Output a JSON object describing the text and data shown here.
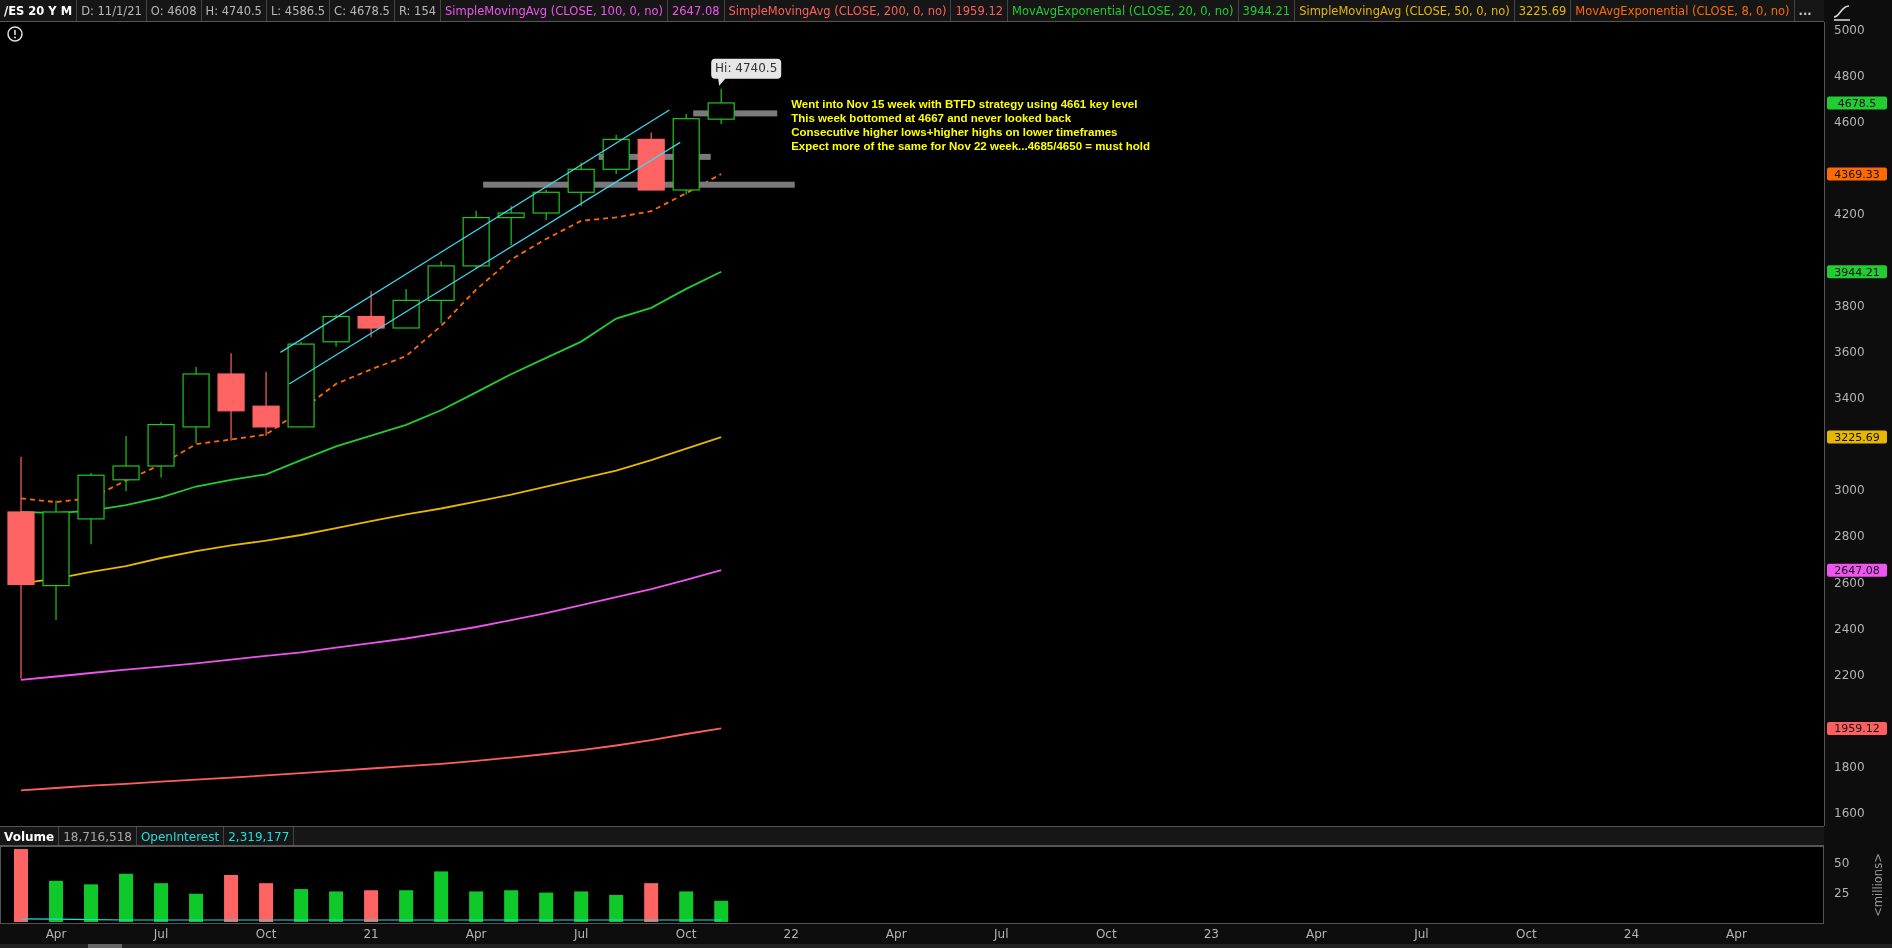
{
  "legend": [
    {
      "kind": "symbol",
      "text": "/ES 20 Y M",
      "color": "#ffffff"
    },
    {
      "kind": "field",
      "text": "D: 11/1/21",
      "color": "#b8b8b8"
    },
    {
      "kind": "field",
      "text": "O: 4608",
      "color": "#b8b8b8"
    },
    {
      "kind": "field",
      "text": "H: 4740.5",
      "color": "#b8b8b8"
    },
    {
      "kind": "field",
      "text": "L: 4586.5",
      "color": "#b8b8b8"
    },
    {
      "kind": "field",
      "text": "C: 4678.5",
      "color": "#b8b8b8"
    },
    {
      "kind": "field",
      "text": "R: 154",
      "color": "#b8b8b8"
    },
    {
      "kind": "study",
      "text": "SimpleMovingAvg (CLOSE, 100, 0, no)",
      "color": "#ee55ee"
    },
    {
      "kind": "study",
      "text": "2647.08",
      "color": "#ee55ee"
    },
    {
      "kind": "study",
      "text": "SimpleMovingAvg (CLOSE, 200, 0, no)",
      "color": "#ff5f5f"
    },
    {
      "kind": "study",
      "text": "1959.12",
      "color": "#ff5f5f"
    },
    {
      "kind": "study",
      "text": "MovAvgExponential (CLOSE, 20, 0, no)",
      "color": "#22cc33"
    },
    {
      "kind": "study",
      "text": "3944.21",
      "color": "#22cc33"
    },
    {
      "kind": "study",
      "text": "SimpleMovingAvg (CLOSE, 50, 0, no)",
      "color": "#e6b800"
    },
    {
      "kind": "study",
      "text": "3225.69",
      "color": "#e6b800"
    },
    {
      "kind": "study",
      "text": "MovAvgExponential (CLOSE, 8, 0, no)",
      "color": "#ff6a00"
    },
    {
      "kind": "more",
      "text": "..."
    }
  ],
  "price_chart": {
    "axis_labels": [
      "5000",
      "4800",
      "4600",
      "4200",
      "3800",
      "3600",
      "3400",
      "3000",
      "2800",
      "2600",
      "2400",
      "2200",
      "1800",
      "1600"
    ],
    "high_label": "Hi: 4740.5",
    "note_lines": [
      "Went into Nov 15 week with BTFD strategy using  4661 key level",
      "This week bottomed at 4667 and never looked back",
      "Consecutive higher lows+higher highs on lower timeframes",
      "Expect more of the same for Nov 22 week...4685/4650 = must hold"
    ],
    "price_badges": [
      {
        "text": "4678.5",
        "color": "#22cc33"
      },
      {
        "text": "4369.33",
        "color": "#ff6a00"
      },
      {
        "text": "3944.21",
        "color": "#22cc33"
      },
      {
        "text": "3225.69",
        "color": "#e6b800"
      },
      {
        "text": "2647.08",
        "color": "#ee55ee"
      },
      {
        "text": "1959.12",
        "color": "#ff5f5f"
      }
    ]
  },
  "volume_panel": {
    "legend": [
      {
        "text": "Volume",
        "color": "#ffffff"
      },
      {
        "text": "18,716,518",
        "color": "#a8a8a8"
      },
      {
        "text": "OpenInterest",
        "color": "#22dddd"
      },
      {
        "text": "2,319,177",
        "color": "#22dddd"
      }
    ],
    "axis_labels": [
      "50",
      "25"
    ],
    "axis_title": "<millions>"
  },
  "time_axis": [
    "Apr",
    "Jul",
    "Oct",
    "21",
    "Apr",
    "Jul",
    "Oct",
    "22",
    "Apr",
    "Jul",
    "Oct",
    "23",
    "Apr",
    "Jul",
    "Oct",
    "24",
    "Apr"
  ]
}
